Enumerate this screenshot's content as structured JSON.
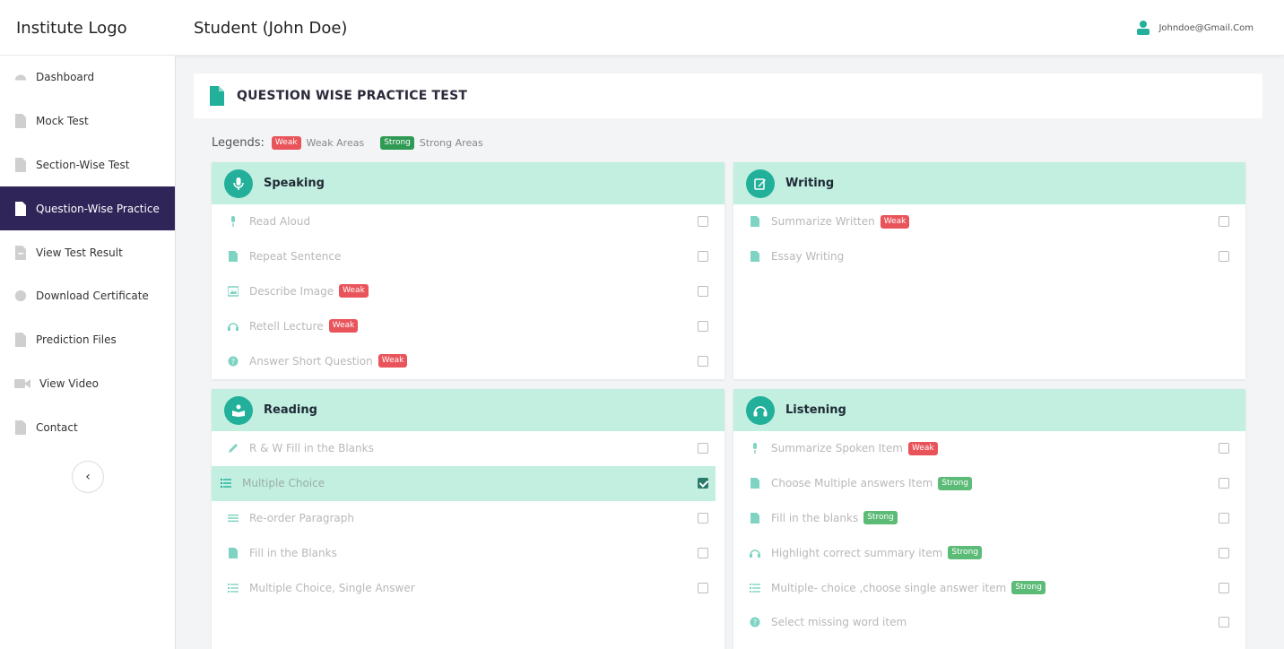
{
  "header": {
    "logo": "Institute Logo",
    "title": "Student (John Doe)",
    "email": "Johndoe@Gmail.Com"
  },
  "sidebar": {
    "items": [
      {
        "label": "Dashboard",
        "icon": "dashboard-icon"
      },
      {
        "label": "Mock Test",
        "icon": "document-icon"
      },
      {
        "label": "Section-Wise Test",
        "icon": "document-icon"
      },
      {
        "label": "Question-Wise Practice",
        "icon": "document-icon"
      },
      {
        "label": "View Test Result",
        "icon": "result-icon"
      },
      {
        "label": "Download Certificate",
        "icon": "certificate-icon"
      },
      {
        "label": "Prediction Files",
        "icon": "document-icon"
      },
      {
        "label": "View Video",
        "icon": "video-icon"
      },
      {
        "label": "Contact",
        "icon": "contact-icon"
      }
    ],
    "active_index": 3,
    "collapse_label": "‹"
  },
  "page": {
    "title": "QUESTION WISE PRACTICE TEST"
  },
  "legends": {
    "title": "Legends:",
    "weak_badge": "Weak",
    "weak_text": "Weak Areas",
    "strong_badge": "Strong",
    "strong_text": "Strong Areas"
  },
  "colors": {
    "accent": "#22b09a",
    "card_header": "#c2efdf",
    "active_nav": "#2f2559",
    "weak": "#e9545a",
    "strong": "#2f9a54"
  },
  "sections": {
    "speaking": {
      "title": "Speaking",
      "icon": "microphone-icon",
      "items": [
        {
          "label": "Read Aloud",
          "badge": ""
        },
        {
          "label": "Repeat Sentence",
          "badge": ""
        },
        {
          "label": "Describe Image",
          "badge": "Weak"
        },
        {
          "label": "Retell Lecture",
          "badge": "Weak"
        },
        {
          "label": "Answer Short Question",
          "badge": "Weak"
        }
      ]
    },
    "writing": {
      "title": "Writing",
      "icon": "edit-icon",
      "items": [
        {
          "label": "Summarize Written",
          "badge": "Weak"
        },
        {
          "label": "Essay Writing",
          "badge": ""
        }
      ]
    },
    "reading": {
      "title": "Reading",
      "icon": "reading-icon",
      "items": [
        {
          "label": "R & W Fill in the Blanks",
          "badge": ""
        },
        {
          "label": "Multiple Choice",
          "badge": "",
          "checked": true
        },
        {
          "label": "Re-order Paragraph",
          "badge": ""
        },
        {
          "label": "Fill in the Blanks",
          "badge": ""
        },
        {
          "label": "Multiple Choice, Single Answer",
          "badge": ""
        }
      ]
    },
    "listening": {
      "title": "Listening",
      "icon": "headphones-icon",
      "items": [
        {
          "label": "Summarize Spoken Item",
          "badge": "Weak"
        },
        {
          "label": "Choose Multiple answers Item",
          "badge": "Strong"
        },
        {
          "label": "Fill in the blanks",
          "badge": "Strong"
        },
        {
          "label": "Highlight correct summary item",
          "badge": "Strong"
        },
        {
          "label": "Multiple- choice ,choose single answer item",
          "badge": "Strong"
        },
        {
          "label": "Select missing word item",
          "badge": ""
        }
      ]
    }
  }
}
